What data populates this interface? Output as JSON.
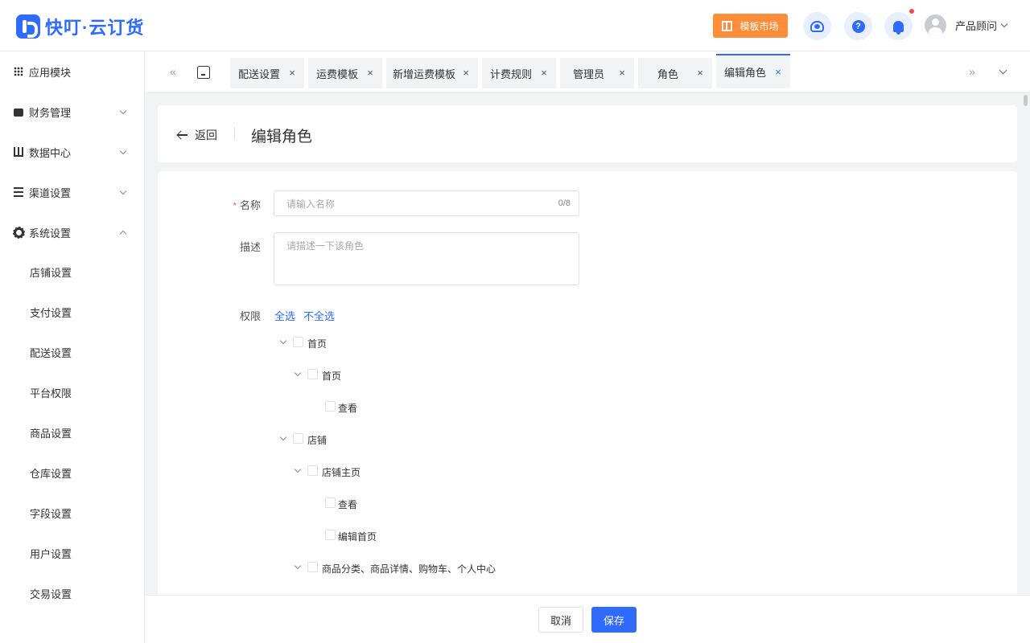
{
  "header": {
    "logo_text": "快叮·云订货",
    "market_label": "模板市场",
    "help_glyph": "?",
    "user_name": "产品顾问",
    "accent_color": "#2f6bff",
    "market_color": "#ff8d3a"
  },
  "sidebar": {
    "menus": [
      {
        "label": "应用模块",
        "icon": "grid-icon"
      },
      {
        "label": "财务管理",
        "icon": "wallet-icon"
      },
      {
        "label": "数据中心",
        "icon": "bar-chart-icon"
      },
      {
        "label": "渠道设置",
        "icon": "list-icon"
      },
      {
        "label": "系统设置",
        "icon": "gear-icon"
      }
    ],
    "sub_items": [
      "店铺设置",
      "支付设置",
      "配送设置",
      "平台权限",
      "商品设置",
      "仓库设置",
      "字段设置",
      "用户设置",
      "交易设置"
    ]
  },
  "tabs": {
    "prev_glyph": "«",
    "next_glyph": "»",
    "close_glyph": "×",
    "items": [
      "配送设置",
      "运费模板",
      "新增运费模板",
      "计费规则",
      "管理员",
      "角色",
      "编辑角色"
    ]
  },
  "page": {
    "back_label": "返回",
    "title": "编辑角色"
  },
  "form": {
    "name_label": "名称",
    "required_mark": "*",
    "name_placeholder": "请输入名称",
    "name_count": "0/8",
    "desc_label": "描述",
    "desc_placeholder": "请描述一下该角色",
    "perm_label": "权限",
    "select_all": "全选",
    "deselect_all": "不全选"
  },
  "tree": [
    {
      "label": "首页",
      "level": 0,
      "expandable": true
    },
    {
      "label": "首页",
      "level": 1,
      "expandable": true
    },
    {
      "label": "查看",
      "level": 2,
      "expandable": false
    },
    {
      "label": "店铺",
      "level": 0,
      "expandable": true
    },
    {
      "label": "店铺主页",
      "level": 1,
      "expandable": true
    },
    {
      "label": "查看",
      "level": 2,
      "expandable": false
    },
    {
      "label": "编辑首页",
      "level": 2,
      "expandable": false
    },
    {
      "label": "商品分类、商品详情、购物车、个人中心",
      "level": 1,
      "expandable": true
    }
  ],
  "footer": {
    "cancel_label": "取消",
    "save_label": "保存"
  }
}
